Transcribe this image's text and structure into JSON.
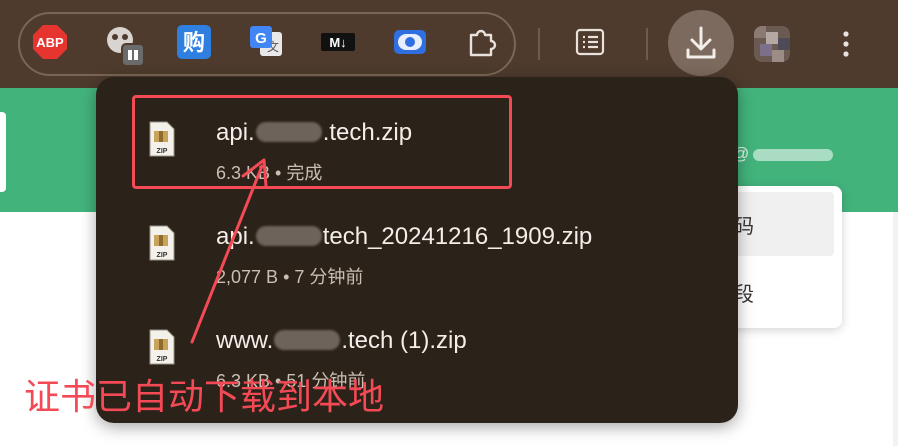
{
  "toolbar": {
    "extensions": [
      {
        "name": "adblock-plus-icon",
        "label": "ABP"
      },
      {
        "name": "ghost-extension-icon",
        "label": ""
      },
      {
        "name": "gouwu-extension-icon",
        "label": "购"
      },
      {
        "name": "google-translate-icon",
        "label": "G"
      },
      {
        "name": "markdown-icon",
        "label": "M↓"
      },
      {
        "name": "screen-record-icon",
        "label": ""
      },
      {
        "name": "extensions-puzzle-icon",
        "label": ""
      }
    ]
  },
  "background_page": {
    "user_handle": "@"
  },
  "downloads": {
    "items": [
      {
        "name_prefix": "api.",
        "name_suffix": ".tech.zip",
        "size": "6.3 KB",
        "status": "完成"
      },
      {
        "name_prefix": "api.",
        "name_suffix": "tech_20241216_1909.zip",
        "size": "2,077 B",
        "status": "7 分钟前"
      },
      {
        "name_prefix": "www.",
        "name_suffix": ".tech (1).zip",
        "size": "6.3 KB",
        "status": "51 分钟前"
      }
    ]
  },
  "annotation": {
    "text": "证书已自动下载到本地"
  },
  "colors": {
    "toolbar_bg": "#4e3b2d",
    "bubble_bg": "#2b2219",
    "accent_green": "#43b37c",
    "annotation_red": "#f44a56"
  }
}
